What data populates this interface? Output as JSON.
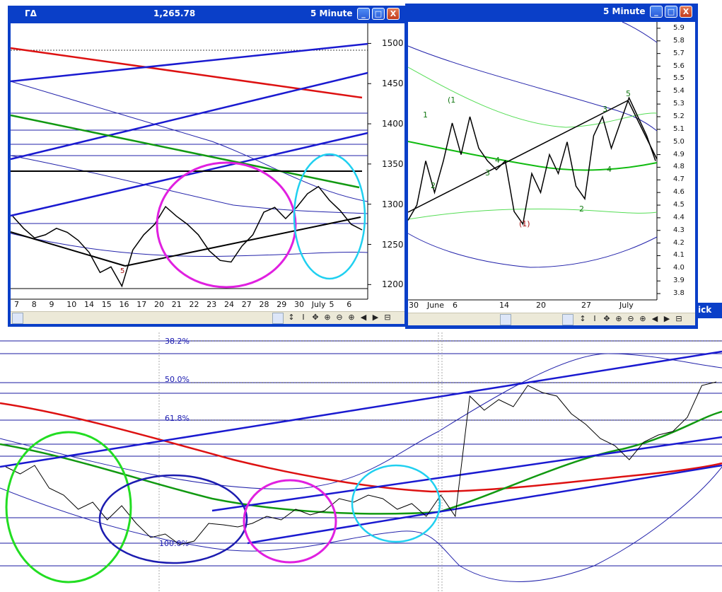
{
  "colors": {
    "blue": "#1a1ad0",
    "thin_blue": "#2222aa",
    "red": "#dd1111",
    "green": "#119911",
    "black": "#000000",
    "magenta": "#e020e0",
    "cyan": "#20d0f0",
    "lightgreen": "#22dd22",
    "navy": "#1c1cb0",
    "ltgreen_ma": "#55dd55"
  },
  "window_left": {
    "title_symbol": "ΓΔ",
    "title_price": "1,265.78",
    "title_interval": "5 Minute",
    "btn_min": "_",
    "btn_max": "□",
    "btn_close": "X",
    "y_ticks": [
      "1500",
      "1450",
      "1400",
      "1350",
      "1300",
      "1250",
      "1200"
    ],
    "x_ticks": [
      "7",
      "8",
      "9",
      "10",
      "14",
      "15",
      "16",
      "17",
      "20",
      "21",
      "22",
      "23",
      "24",
      "27",
      "28",
      "29",
      "30",
      "July",
      "5",
      "6"
    ],
    "wave_label": "5"
  },
  "window_right": {
    "title_interval": "5 Minute",
    "btn_min": "_",
    "btn_max": "□",
    "btn_close": "X",
    "y_ticks": [
      "5.9",
      "5.8",
      "5.7",
      "5.6",
      "5.5",
      "5.4",
      "5.3",
      "5.2",
      "5.1",
      "5.0",
      "4.9",
      "4.8",
      "4.7",
      "4.6",
      "4.5",
      "4.4",
      "4.3",
      "4.2",
      "4.1",
      "4.0",
      "3.9",
      "3.8"
    ],
    "x_ticks": [
      "30",
      "June",
      "6",
      "14",
      "20",
      "27",
      "July"
    ],
    "wave_labels": [
      "1",
      "(1",
      "2",
      "3",
      "4",
      "5",
      "(1)",
      "2",
      "3",
      "4",
      "5"
    ],
    "partial_label": "ick"
  },
  "toolbar_glyphs": [
    "↕",
    "I",
    "✥",
    "⊕",
    "⊖",
    "⊕",
    "◀",
    "▶",
    "⊟"
  ],
  "bottom": {
    "fib_levels": [
      "38.2%",
      "50.0%",
      "61.8%",
      "100.0%"
    ]
  },
  "chart_data": [
    {
      "type": "line",
      "y_axis_ticks": [
        1500,
        1450,
        1400,
        1350,
        1300,
        1250,
        1200
      ],
      "ylim": [
        1195,
        1525
      ],
      "x_categories": [
        "7",
        "8",
        "9",
        "10",
        "14",
        "15",
        "16",
        "17",
        "20",
        "21",
        "22",
        "23",
        "24",
        "27",
        "28",
        "29",
        "30",
        "July",
        "5",
        "6"
      ],
      "series": [
        {
          "values": [
            1285,
            1270,
            1258,
            1262,
            1270,
            1265,
            1255,
            1240,
            1215,
            1222,
            1198,
            1243,
            1262,
            1275,
            1297,
            1285,
            1275,
            1262,
            1242,
            1230,
            1228,
            1248,
            1262,
            1290,
            1296,
            1282,
            1296,
            1313,
            1322,
            1305,
            1292,
            1275,
            1268
          ]
        }
      ],
      "wave_label": "5"
    },
    {
      "type": "line",
      "y_axis_ticks": [
        5.9,
        5.8,
        5.7,
        5.6,
        5.5,
        5.4,
        5.3,
        5.2,
        5.1,
        5.0,
        4.9,
        4.8,
        4.7,
        4.6,
        4.5,
        4.4,
        4.3,
        4.2,
        4.1,
        4.0,
        3.9,
        3.8
      ],
      "ylim": [
        3.75,
        5.95
      ],
      "x_categories": [
        "30",
        "June",
        "6",
        "14",
        "20",
        "27",
        "July"
      ],
      "series": [
        {
          "values": [
            4.38,
            4.5,
            4.85,
            4.6,
            4.85,
            5.15,
            4.9,
            5.2,
            4.95,
            4.85,
            4.78,
            4.85,
            4.45,
            4.35,
            4.75,
            4.6,
            4.9,
            4.75,
            5.0,
            4.65,
            4.55,
            5.05,
            5.2,
            4.95,
            5.15,
            5.35,
            5.2,
            5.05,
            4.85
          ]
        }
      ],
      "wave_labels": [
        "1",
        "(1",
        "2",
        "3",
        "4",
        "5",
        "(1)",
        "2",
        "3",
        "4",
        "5"
      ]
    },
    {
      "type": "line",
      "fib_levels": [
        "38.2%",
        "50.0%",
        "61.8%",
        "100.0%"
      ],
      "series": [
        {
          "values": [
            660,
            670,
            658,
            690,
            700,
            720,
            710,
            735,
            715,
            740,
            760,
            755,
            770,
            765,
            740,
            742,
            745,
            740,
            730,
            735,
            720,
            728,
            722,
            705,
            710,
            700,
            705,
            720,
            712,
            730,
            700,
            730,
            560,
            580,
            565,
            575,
            545,
            555,
            560,
            585,
            600,
            620,
            630,
            650,
            625,
            615,
            610,
            590,
            545,
            540
          ]
        }
      ]
    }
  ]
}
